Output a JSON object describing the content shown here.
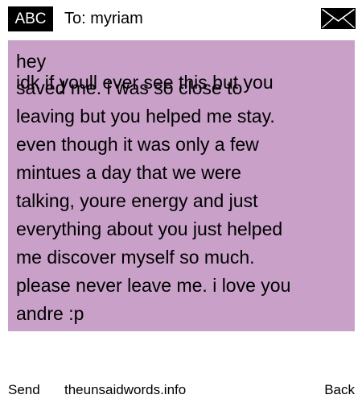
{
  "header": {
    "badge_label": "ABC",
    "to_line": "To: myriam",
    "envelope_icon": "envelope-icon"
  },
  "message": {
    "first_line": "hey",
    "overlap_line": "idk if youll ever see this but you",
    "body": "saved me. i was so close to\nleaving but you helped me stay.\neven though it was only a few\nmintues a day that we were\ntalking, youre energy and just\neverything about you just helped\nme discover myself so much.\nplease never leave me. i love you\nandre :p"
  },
  "footer": {
    "send_label": "Send",
    "site_label": "theunsaidwords.info",
    "back_label": "Back"
  },
  "colors": {
    "message_background": "#c8a0c8",
    "badge_background": "#000000",
    "page_background": "#ffffff"
  }
}
